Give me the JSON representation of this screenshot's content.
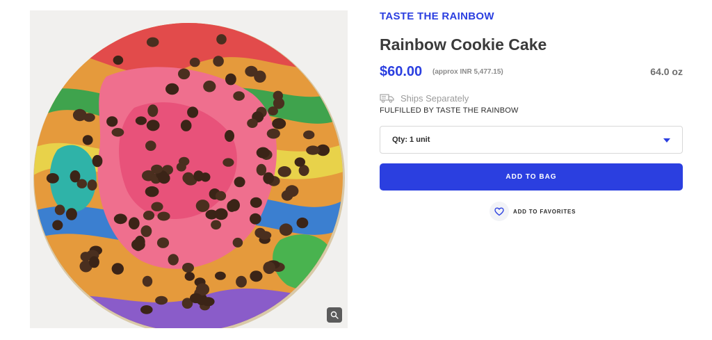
{
  "brand": "TASTE THE RAINBOW",
  "product": {
    "title": "Rainbow Cookie Cake",
    "price": "$60.00",
    "price_approx": "(approx INR 5,477.15)",
    "size": "64.0 oz",
    "image_alt": "Rainbow Cookie Cake with chocolate chips"
  },
  "shipping": {
    "ships_label": "Ships Separately",
    "fulfilled_label": "FULFILLED BY TASTE THE RAINBOW",
    "icon": "truck-icon"
  },
  "quantity": {
    "selected": "Qty: 1 unit"
  },
  "actions": {
    "add_to_bag": "ADD TO BAG",
    "add_to_favorites": "ADD TO FAVORITES"
  },
  "colors": {
    "accent": "#2b3fe0",
    "muted": "#9b9b9b"
  }
}
